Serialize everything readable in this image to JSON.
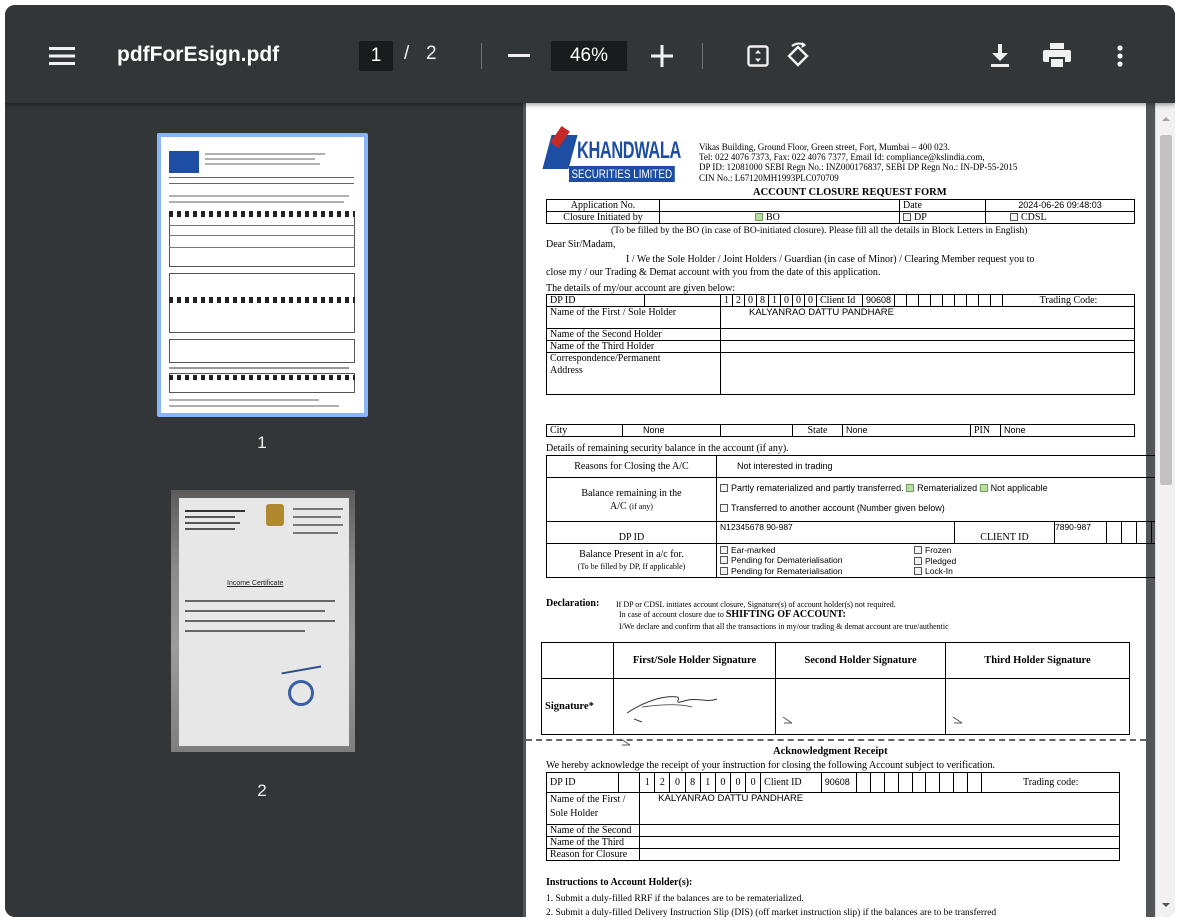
{
  "toolbar": {
    "menu_icon": "hamburger-menu-icon",
    "file_name": "pdfForEsign.pdf",
    "current_page": "1",
    "page_separator": "/",
    "total_pages": "2",
    "zoom_level": "46%",
    "zoom_out_icon": "minus-icon",
    "zoom_in_icon": "plus-icon",
    "fit_icon": "fit-to-page-icon",
    "rotate_icon": "rotate-counterclockwise-icon",
    "download_icon": "download-icon",
    "print_icon": "print-icon",
    "more_icon": "more-vertical-icon"
  },
  "sidebar": {
    "thumbnails": [
      {
        "label": "1",
        "selected": true
      },
      {
        "label": "2",
        "selected": false
      }
    ]
  },
  "document": {
    "logo_top": "KHANDWALA",
    "logo_bottom": "SECURITIES LIMITED",
    "address_line1": "Vikas Building, Ground Floor, Green street, Fort, Mumbai – 400 023.",
    "address_line2": "Tel: 022 4076 7373, Fax: 022 4076 7377, Email Id: compliance@kslindia.com,",
    "address_line3": "DP ID: 12081000 SEBI Regn No.: INZ000176837, SEBI DP Regn No.: IN-DP-55-2015",
    "address_line4": "CIN No.: L67120MH1993PLC070709",
    "form_title": "ACCOUNT CLOSURE REQUEST FORM",
    "application_no_label": "Application No.",
    "date_label": "Date",
    "date_value": "2024-06-26 09:48:03",
    "closure_initiated_label": "Closure Initiated by",
    "opt_bo": "BO",
    "opt_dp": "DP",
    "opt_cdsl": "CDSL",
    "fill_note": "(To be filled by the BO (in case of BO-initiated closure). Please fill all the details in Block Letters in English)",
    "salutation": "Dear Sir/Madam,",
    "body_line1": "I / We the Sole Holder / Joint Holders / Guardian (in case of Minor) / Clearing Member request you to",
    "body_line2": "close my / our Trading & Demat account with you from the date of this application.",
    "details_heading": "The details of my/our account are given below:",
    "dp_id_label": "DP ID",
    "dp_id_digits": [
      "1",
      "2",
      "0",
      "8",
      "1",
      "0",
      "0",
      "0"
    ],
    "client_id_label": "Client Id",
    "client_id_value": "90608",
    "trading_code_label": "Trading Code:",
    "first_holder_label": "Name of the First / Sole Holder",
    "first_holder_value": "KALYANRAO DATTU PANDHARE",
    "second_holder_label": "Name of the Second Holder",
    "third_holder_label": "Name of the Third Holder",
    "address_label_1": "Correspondence/Permanent",
    "address_label_2": "Address",
    "city_label": "City",
    "city_value": "None",
    "state_label": "State",
    "state_value": "None",
    "pin_label": "PIN",
    "pin_value": "None",
    "remaining_heading": "Details of remaining security balance in the account (if any).",
    "reasons_label": "Reasons for Closing the A/C",
    "reasons_value": "Not interested in trading",
    "balance_label_1": "Balance remaining in the",
    "balance_label_2": "A/C",
    "balance_label_2b": "(if any)",
    "balance_opt1": "Partly rematerialized and partly transferred.",
    "balance_opt2": "Rematerialized",
    "balance_opt3": "Not applicable",
    "balance_opt4": "Transferred to another account (Number given below)",
    "dp_id_label2": "DP ID",
    "dp_id_value2": "N12345678 90-987",
    "client_id_label2": "CLIENT ID",
    "client_id_value2": "7890-987",
    "present_label_1": "Balance Present in a/c for.",
    "present_label_2": "(To be filled by DP, If applicable)",
    "present_opts": [
      "Ear-marked",
      "Pending for Dematerialisation",
      "Pending for Rematerialisation"
    ],
    "present_opts_right": [
      "Frozen",
      "Pledged",
      "Lock-In"
    ],
    "declaration_label": "Declaration:",
    "declaration_line1": "If DP or CDSL initiates account closure, Signature(s) of account holder(s) not required.",
    "declaration_line2_pre": "In case of account closure due to",
    "declaration_line2_bold": "SHIFTING OF ACCOUNT:",
    "declaration_line3": "I/We declare and confirm that all the transactions in my/our trading & demat account are true/authentic",
    "sig_first": "First/Sole Holder Signature",
    "sig_second": "Second Holder Signature",
    "sig_third": "Third Holder Signature",
    "signature_label": "Signature*",
    "ack_title": "Acknowledgment Receipt",
    "ack_line": "We hereby acknowledge the receipt of your instruction for closing the following Account subject to verification.",
    "ack_dp_label": "DP ID",
    "ack_client_label": "Client ID",
    "ack_client_value": "90608",
    "ack_trading_label": "Trading code:",
    "ack_first_label_1": "Name of the First /",
    "ack_first_label_2": "Sole Holder",
    "ack_first_value": "KALYANRAO DATTU PANDHARE",
    "ack_second_label": "Name of the Second",
    "ack_third_label": "Name of the Third",
    "ack_reason_label": "Reason for Closure",
    "instructions_heading": "Instructions to Account Holder(s):",
    "instruction_1": "1. Submit a duly-filled RRF if the balances are to be rematerialized.",
    "instruction_2": "2. Submit a duly-filled Delivery Instruction Slip (DIS) (off market instruction slip) if the balances are to be transferred"
  },
  "thumb2": {
    "caption": "Income Certificate"
  }
}
